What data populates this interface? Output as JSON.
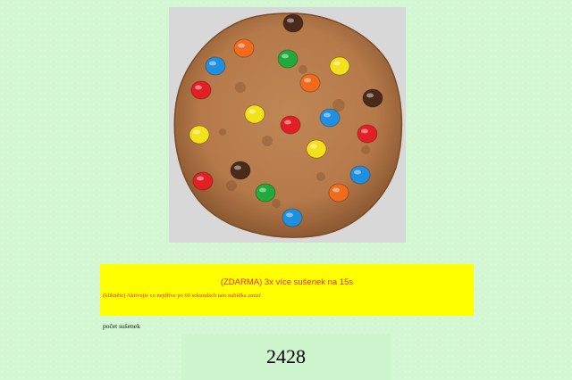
{
  "cookie": {
    "icon": "cookie-with-candies",
    "panel_color": "#d8d8d8",
    "dough_color": "#b67a4a",
    "candy_colors": [
      "#e31e24",
      "#f5e11a",
      "#1f8fe0",
      "#1faa3a",
      "#f26b1d",
      "#4a2a1a"
    ]
  },
  "offer": {
    "title": "(ZDARMA) 3x více sušenek na 15s",
    "description": "(klikněte) Aktivujte co nejdříve po 60 sekundách tato nabídka zmizí",
    "background_color": "#ffff00",
    "text_color": "#e0302a"
  },
  "counter": {
    "label": "počet sušenek",
    "value": "2428"
  }
}
